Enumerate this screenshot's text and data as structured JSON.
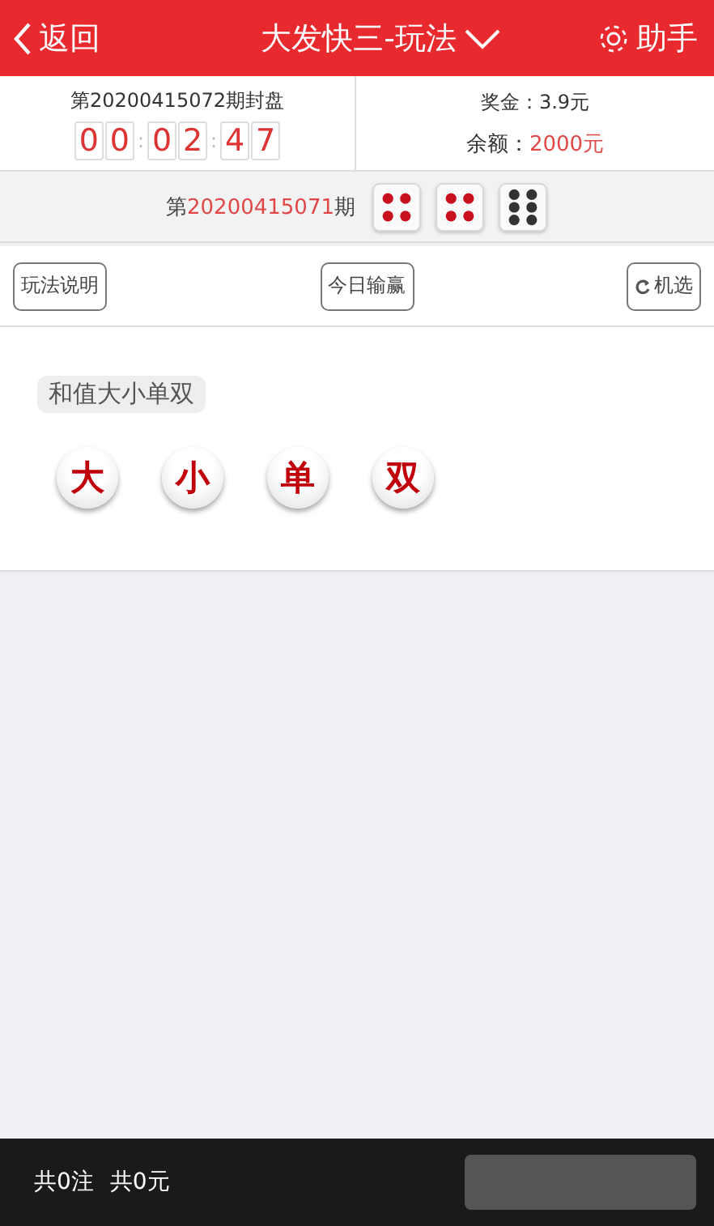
{
  "header": {
    "back": "返回",
    "title": "大发快三-玩法",
    "assistant": "助手"
  },
  "info": {
    "period_label": "第20200415072期封盘",
    "countdown": [
      {
        "kind": "digit",
        "text": "0"
      },
      {
        "kind": "digit",
        "text": "0"
      },
      {
        "kind": "sep",
        "text": ":"
      },
      {
        "kind": "digit",
        "text": "0"
      },
      {
        "kind": "digit",
        "text": "2"
      },
      {
        "kind": "sep",
        "text": ":"
      },
      {
        "kind": "digit",
        "text": "4"
      },
      {
        "kind": "digit",
        "text": "7"
      }
    ],
    "prize": "奖金：3.9元",
    "balance_label": "余额：",
    "balance": "2000元"
  },
  "last_draw": {
    "prefix": "第",
    "period": "20200415071",
    "suffix": "期",
    "dice": [
      {
        "kind": "four",
        "color": "#c8101e"
      },
      {
        "kind": "four",
        "color": "#c8101e"
      },
      {
        "kind": "six",
        "color": "#333333"
      }
    ]
  },
  "tools": [
    "玩法说明",
    "今日输赢",
    "机选"
  ],
  "section": {
    "title": "和值大小单双",
    "balls": [
      {
        "label": "大",
        "selected": false
      },
      {
        "label": "小",
        "selected": false
      },
      {
        "label": "单",
        "selected": false
      },
      {
        "label": "双",
        "selected": false
      }
    ]
  },
  "footer": {
    "count": "共0注",
    "amount": "共0元"
  }
}
